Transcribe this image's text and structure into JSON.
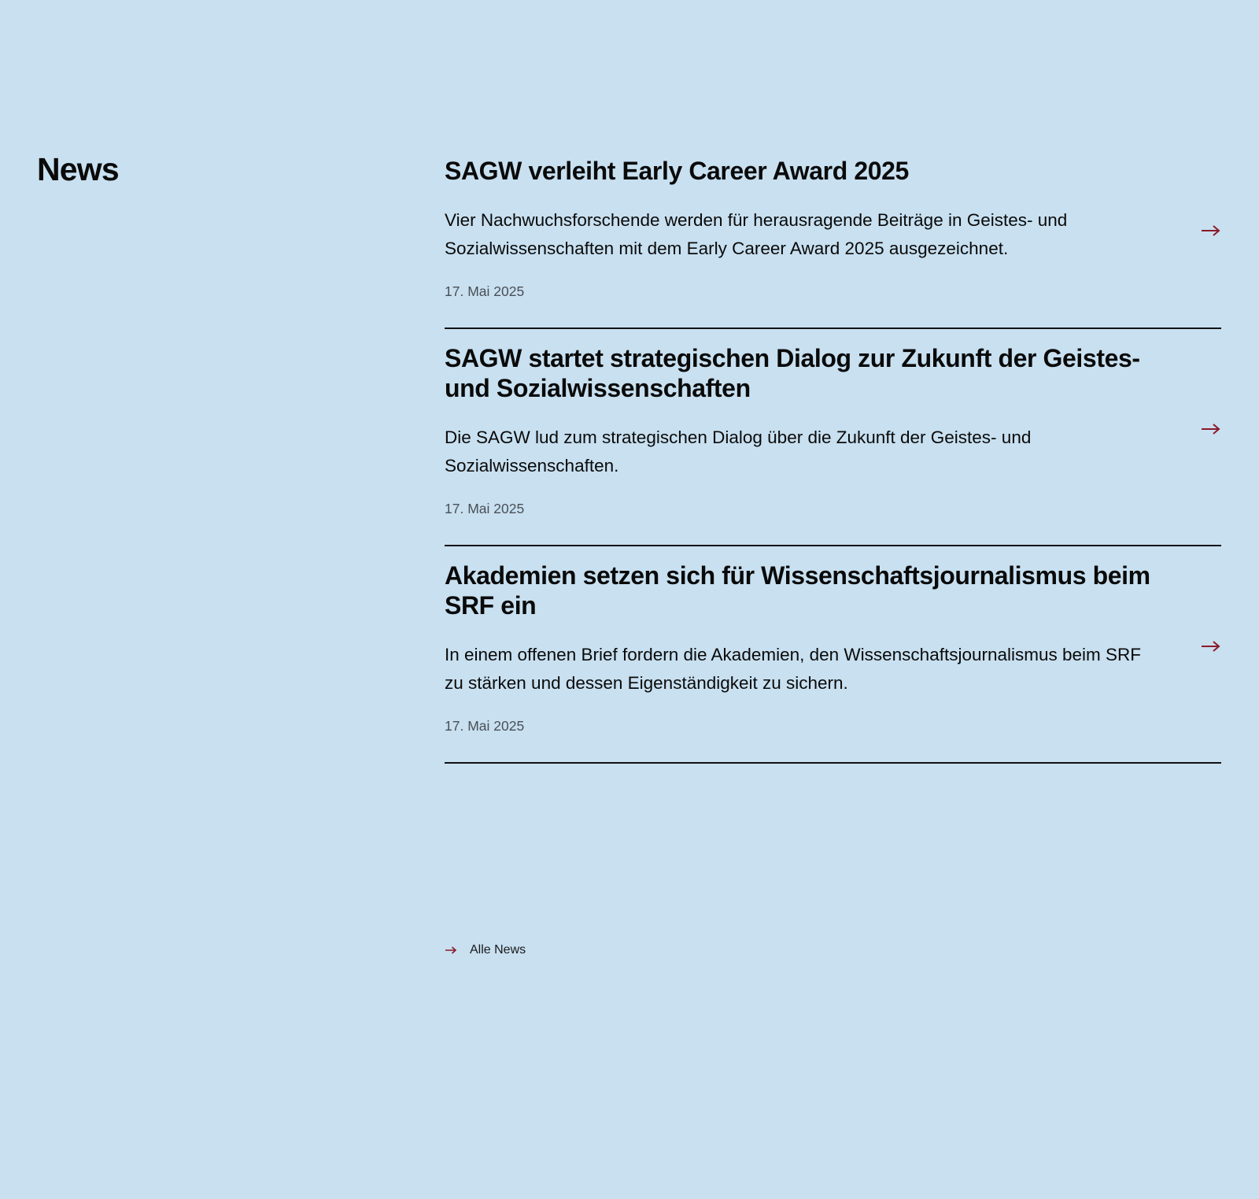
{
  "section": {
    "title": "News"
  },
  "news": [
    {
      "title": "SAGW verleiht Early Career Award 2025",
      "teaser": "Vier Nachwuchsforschende werden für herausragende Beiträge in Geistes- und Sozialwissenschaften mit dem Early Career Award 2025 ausgezeichnet.",
      "date": "17. Mai 2025"
    },
    {
      "title": "SAGW startet strategischen Dialog zur Zukunft der Geistes- und Sozialwissenschaften",
      "teaser": "Die SAGW lud zum strategischen Dialog über die Zukunft der Geistes- und Sozialwissenschaften.",
      "date": "17. Mai 2025"
    },
    {
      "title": "Akademien setzen sich für Wissenschaftsjournalismus beim SRF ein",
      "teaser": "In einem offenen Brief fordern die Akademien, den Wissenschaftsjournalismus beim SRF zu stärken und dessen Eigenständigkeit zu sichern.",
      "date": "17. Mai 2025"
    }
  ],
  "all_news_link": {
    "label": "Alle News",
    "icon": "arrow-right-icon"
  },
  "colors": {
    "background": "#c8e0f0",
    "accent": "#8b1a2b",
    "text": "#0a0a0a",
    "muted": "#4a4f55"
  }
}
